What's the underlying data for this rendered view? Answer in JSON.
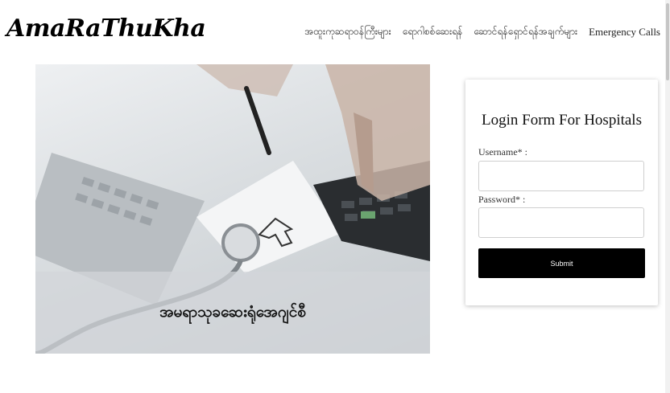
{
  "brand": {
    "logo_text": "AmaRaThuKha"
  },
  "nav": {
    "items": [
      "အထူးကုဆရာဝန်ကြီးများ",
      "ရောဂါစစ်ဆေးရန်",
      "ဆောင်ရန်ရှောင်ရန်အချက်များ",
      "Emergency Calls"
    ]
  },
  "hero": {
    "caption": "အမရာသုခဆေးရုံအေဂျင်စီ"
  },
  "login": {
    "title": "Login Form For Hospitals",
    "username_label": "Username* :",
    "username_value": "",
    "password_label": "Password* :",
    "password_value": "",
    "submit_label": "Submit"
  }
}
